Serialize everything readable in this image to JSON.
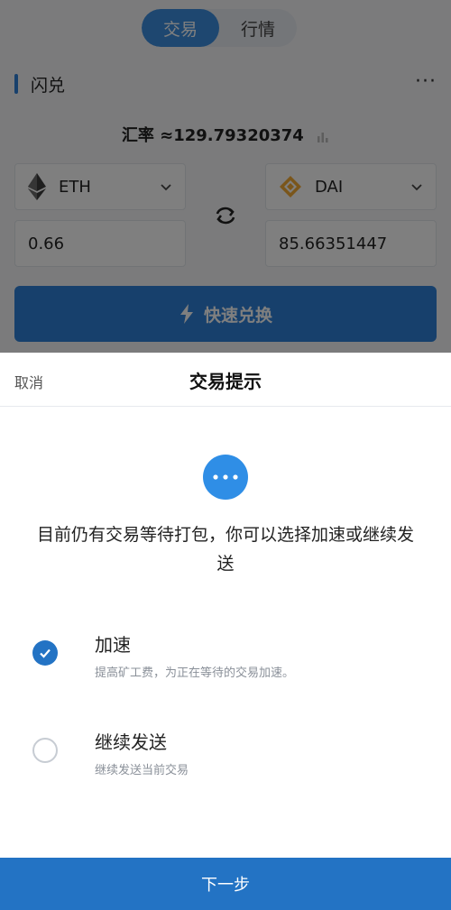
{
  "header": {
    "tabs": [
      {
        "label": "交易",
        "active": true
      },
      {
        "label": "行情",
        "active": false
      }
    ],
    "section_title": "闪兑",
    "more_label": "···"
  },
  "exchange": {
    "rate_text": "汇率 ≈129.79320374",
    "from_token": {
      "symbol": "ETH",
      "icon": "ethereum-icon"
    },
    "to_token": {
      "symbol": "DAI",
      "icon": "dai-icon"
    },
    "from_amount": "0.66",
    "to_amount": "85.66351447",
    "quick_swap_label": "快速兑换"
  },
  "sheet": {
    "cancel_label": "取消",
    "title": "交易提示",
    "message": "目前仍有交易等待打包，你可以选择加速或继续发送",
    "options": [
      {
        "title": "加速",
        "desc": "提高矿工费，为正在等待的交易加速。",
        "selected": true
      },
      {
        "title": "继续发送",
        "desc": "继续发送当前交易",
        "selected": false
      }
    ],
    "next_label": "下一步"
  },
  "colors": {
    "accent": "#2f80d8",
    "primary_button": "#2373c4",
    "eth": "#3c3c3d",
    "dai": "#f5ac37"
  }
}
